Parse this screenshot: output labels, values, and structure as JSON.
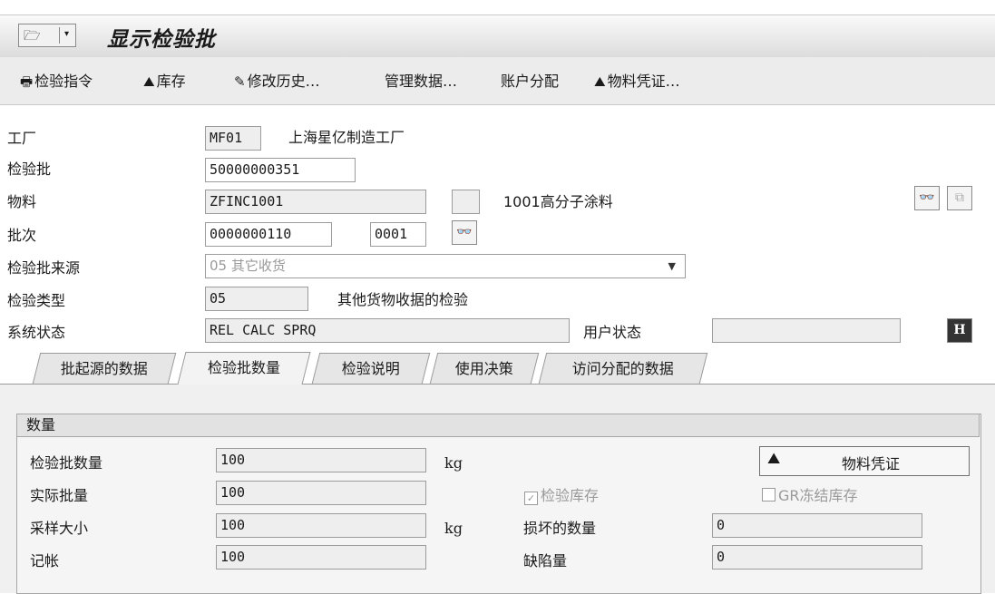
{
  "title": {
    "text": "显示检验批",
    "menu_icon": "menu-icon",
    "dropdown_glyph": "▾"
  },
  "toolbar": [
    {
      "label": "检验指令",
      "icon": "print-icon"
    },
    {
      "label": "库存",
      "icon": "stock-icon"
    },
    {
      "label": "修改历史…",
      "icon": "history-icon"
    },
    {
      "label": "管理数据…",
      "icon": ""
    },
    {
      "label": "账户分配",
      "icon": ""
    },
    {
      "label": "物料凭证…",
      "icon": "material-doc-icon"
    }
  ],
  "form": {
    "plant": {
      "label": "工厂",
      "value": "MF01",
      "desc": "上海星亿制造工厂"
    },
    "lot": {
      "label": "检验批",
      "value": "50000000351"
    },
    "material": {
      "label": "物料",
      "value": "ZFINC1001",
      "desc": "1001高分子涂料"
    },
    "batch": {
      "label": "批次",
      "value": "0000000110",
      "value2": "0001"
    },
    "origin": {
      "label": "检验批来源",
      "value": "05 其它收货"
    },
    "type": {
      "label": "检验类型",
      "value": "05",
      "desc": "其他货物收据的检验"
    },
    "sys_status": {
      "label": "系统状态",
      "value": "REL  CALC SPRQ"
    },
    "user_status": {
      "label": "用户状态",
      "value": ""
    }
  },
  "tabs": [
    {
      "label": "批起源的数据",
      "active": false
    },
    {
      "label": "检验批数量",
      "active": true
    },
    {
      "label": "检验说明",
      "active": false
    },
    {
      "label": "使用决策",
      "active": false
    },
    {
      "label": "访问分配的数据",
      "active": false
    }
  ],
  "quantities": {
    "title": "数量",
    "lot_qty": {
      "label": "检验批数量",
      "value": "100",
      "unit": "kg"
    },
    "actual_qty": {
      "label": "实际批量",
      "value": "100"
    },
    "sample_size": {
      "label": "采样大小",
      "value": "100",
      "unit": "kg"
    },
    "posted": {
      "label": "记帐",
      "value": "100"
    },
    "insp_stock": {
      "label": "检验库存",
      "checked": true
    },
    "gr_blocked": {
      "label": "GR冻结库存",
      "checked": false
    },
    "destroyed": {
      "label": "损坏的数量",
      "value": "0"
    },
    "defect": {
      "label": "缺陷量",
      "value": "0"
    },
    "mat_doc_button": "物料凭证"
  }
}
